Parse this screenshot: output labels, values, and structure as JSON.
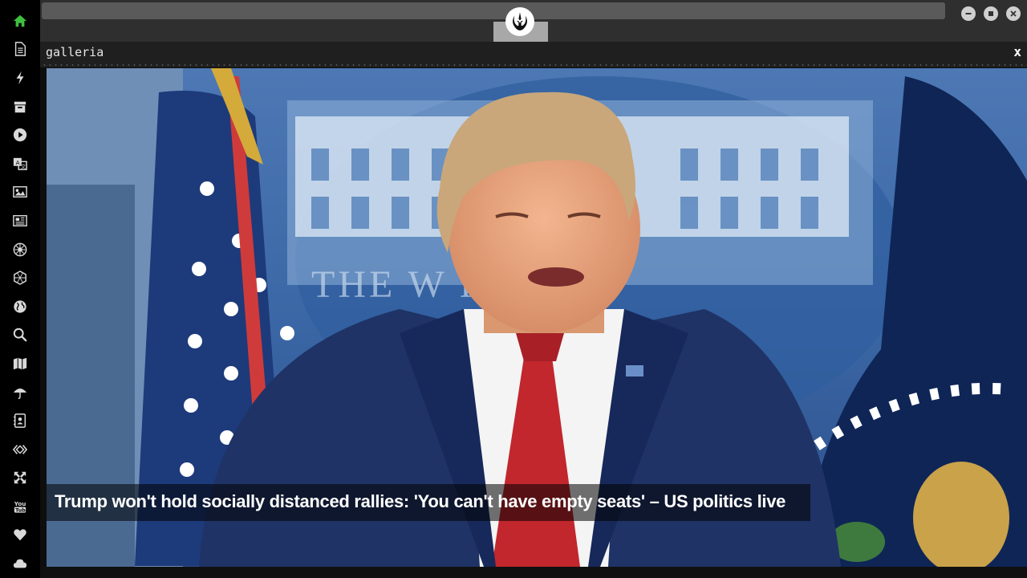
{
  "sidebar": {
    "items": [
      {
        "name": "home-icon",
        "color": "#3fbf3f"
      },
      {
        "name": "document-icon",
        "color": "#d9d9d9"
      },
      {
        "name": "lightning-icon",
        "color": "#d9d9d9"
      },
      {
        "name": "archive-icon",
        "color": "#d9d9d9"
      },
      {
        "name": "play-icon",
        "color": "#d9d9d9"
      },
      {
        "name": "translate-icon",
        "color": "#d9d9d9"
      },
      {
        "name": "image-icon",
        "color": "#d9d9d9"
      },
      {
        "name": "newspaper-icon",
        "color": "#d9d9d9"
      },
      {
        "name": "empire-icon",
        "color": "#d9d9d9"
      },
      {
        "name": "hexagon-icon",
        "color": "#d9d9d9"
      },
      {
        "name": "globe-icon",
        "color": "#d9d9d9"
      },
      {
        "name": "search-icon",
        "color": "#d9d9d9"
      },
      {
        "name": "map-icon",
        "color": "#d9d9d9"
      },
      {
        "name": "umbrella-icon",
        "color": "#d9d9d9"
      },
      {
        "name": "contacts-icon",
        "color": "#d9d9d9"
      },
      {
        "name": "code-icon",
        "color": "#d9d9d9"
      },
      {
        "name": "expand-icon",
        "color": "#d9d9d9"
      },
      {
        "name": "youtube-icon",
        "color": "#d9d9d9"
      },
      {
        "name": "heart-icon",
        "color": "#d9d9d9"
      },
      {
        "name": "cloud-icon",
        "color": "#d9d9d9"
      }
    ]
  },
  "topbar": {
    "logo": "rebel-alliance-icon",
    "window_controls": [
      "minimize-icon",
      "maximize-icon",
      "close-icon"
    ]
  },
  "panel": {
    "title": "galleria",
    "close_label": "x"
  },
  "gallery": {
    "caption": "Trump won't hold socially distanced rallies: 'You can't have empty seats' – US politics live",
    "background_text": "THE W   HOUSE"
  }
}
